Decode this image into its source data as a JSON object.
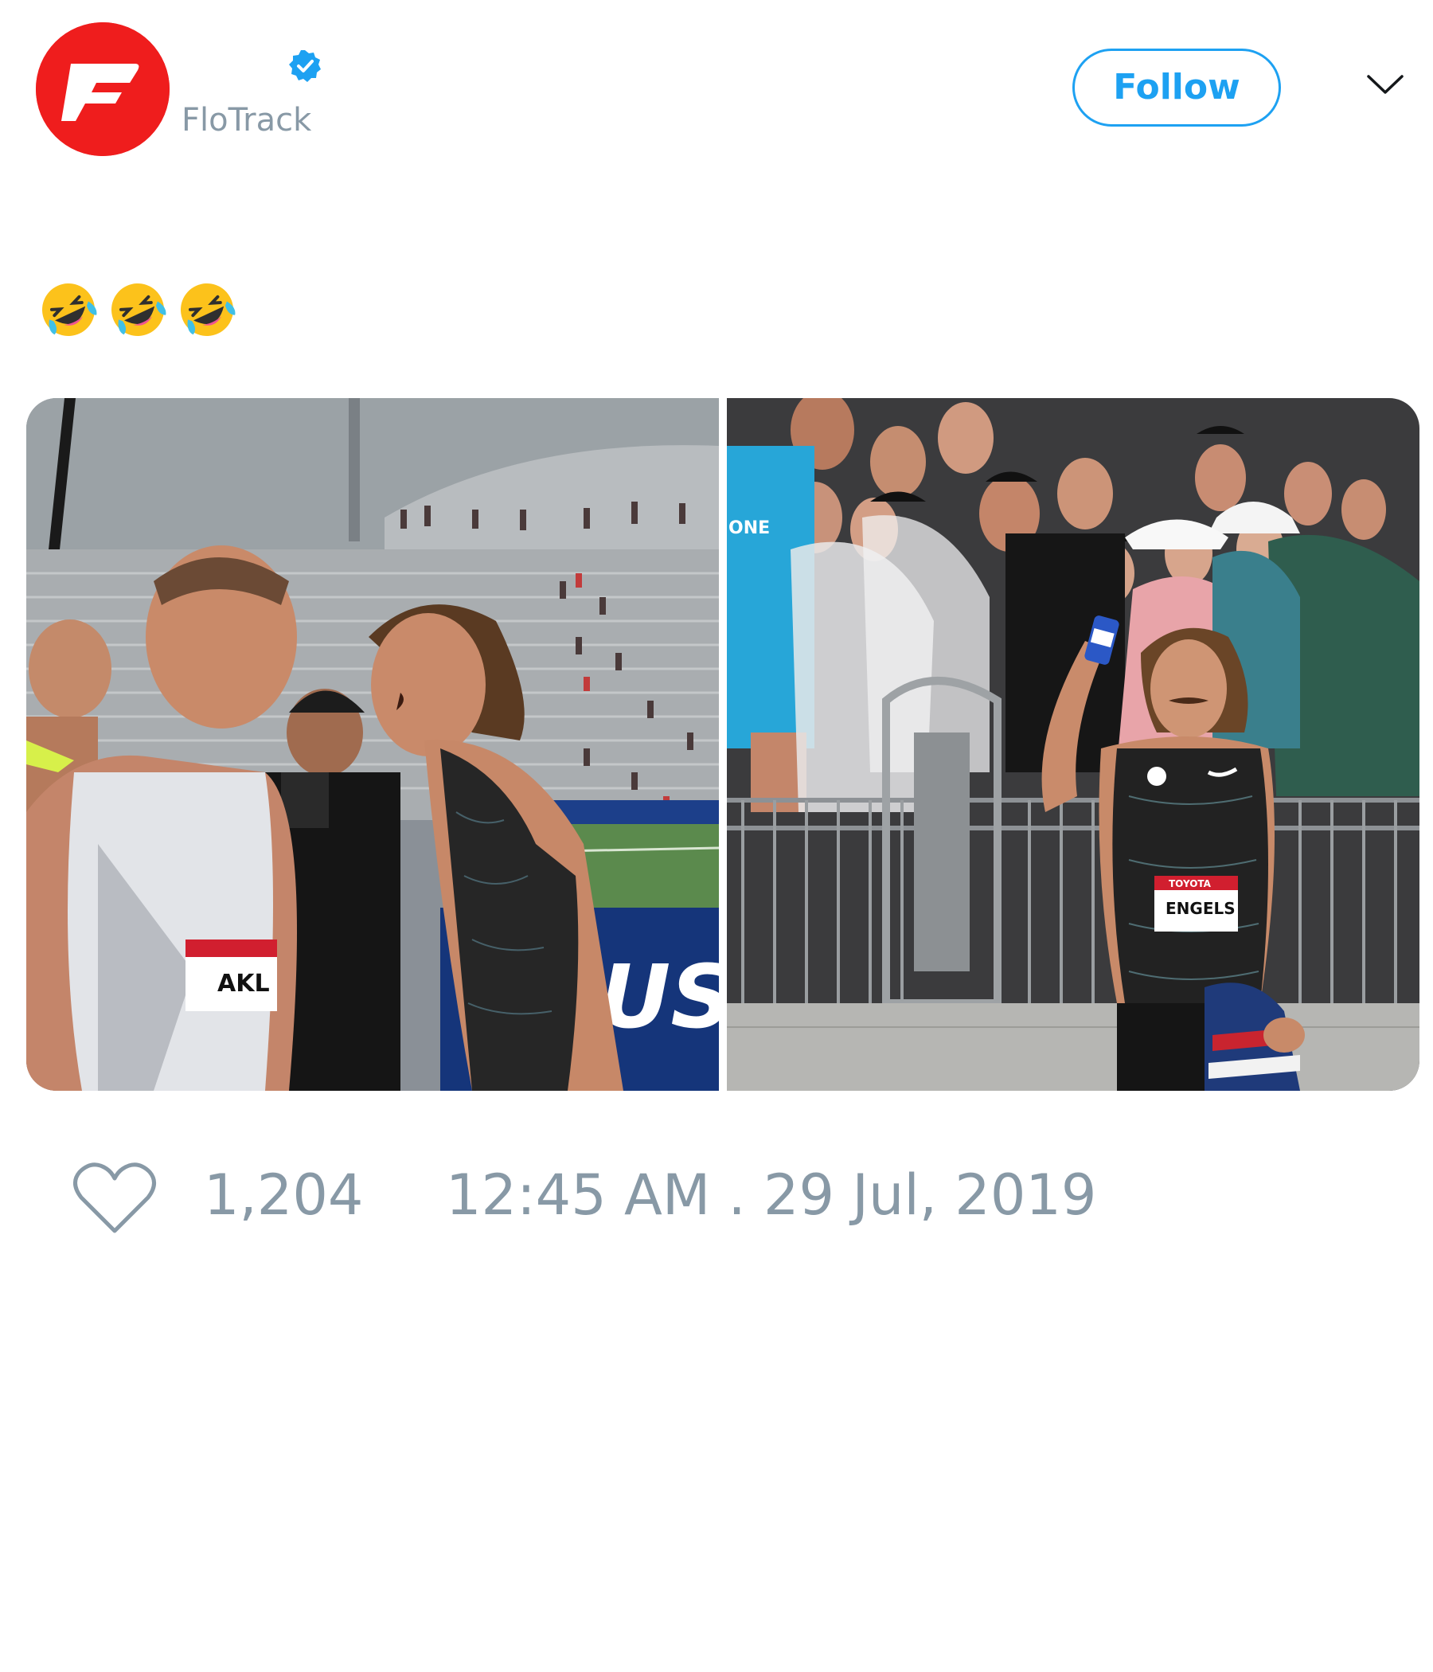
{
  "header": {
    "display_name": "",
    "handle": "FloTrack",
    "verified": true,
    "follow_label": "Follow",
    "avatar_icon": "flotrack-logo",
    "menu_icon": "chevron-down-icon"
  },
  "tweet": {
    "text": "🤣🤣🤣",
    "emoji_icons": [
      "rolling-on-floor-laughing-emoji",
      "rolling-on-floor-laughing-emoji",
      "rolling-on-floor-laughing-emoji"
    ]
  },
  "media": {
    "photos": [
      {
        "bib_text": "AKL",
        "banner_text": "USA"
      },
      {
        "bib_text": "ENGELS",
        "bib_sponsor": "TOYOTA",
        "shirt_text": "ONE"
      }
    ]
  },
  "footer": {
    "like_icon": "heart-icon",
    "like_count": "1,204",
    "timestamp": "12:45 AM . 29 Jul, 2019"
  },
  "colors": {
    "accent": "#1da1f2",
    "muted": "#8899a6",
    "avatar_red": "#ef1d1d"
  }
}
